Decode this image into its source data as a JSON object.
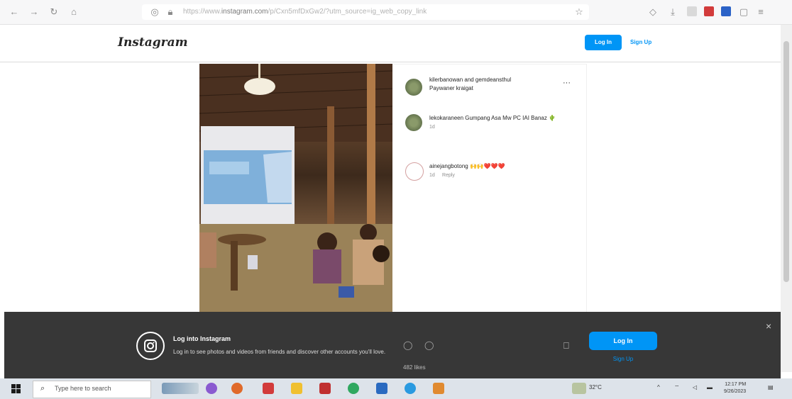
{
  "browser": {
    "url_prefix": "https://www.",
    "url_domain": "instagram.com",
    "url_rest": "/p/Cxn5mfDxGw2/?utm_source=ig_web_copy_link"
  },
  "header": {
    "logo": "Instagram",
    "login_label": "Log In",
    "signup_label": "Sign Up"
  },
  "post": {
    "author_line1": "kilerbanowan and gemdeansthul",
    "author_line2": "Paywaner kraigat",
    "more": "···",
    "comments": [
      {
        "text": "lekokaraneen Gumpang Asa Mw PC IAI Banaz 🌵",
        "time": "1d",
        "reply": ""
      },
      {
        "text": "ainejangbotong 🙌🙌❤️❤️❤️",
        "time": "1d",
        "reply": "Reply"
      }
    ]
  },
  "banner": {
    "title": "Log into Instagram",
    "subtitle": "Log in to see photos and videos from friends and discover other accounts you'll love.",
    "login_label": "Log In",
    "signup_label": "Sign Up",
    "close": "×",
    "likes_hint": "482 likes"
  },
  "taskbar": {
    "search_placeholder": "Type here to search",
    "weather": "32°C",
    "time": "12:17 PM",
    "date": "9/26/2023"
  },
  "colors": {
    "accent": "#0095f6",
    "banner": "#262626"
  }
}
